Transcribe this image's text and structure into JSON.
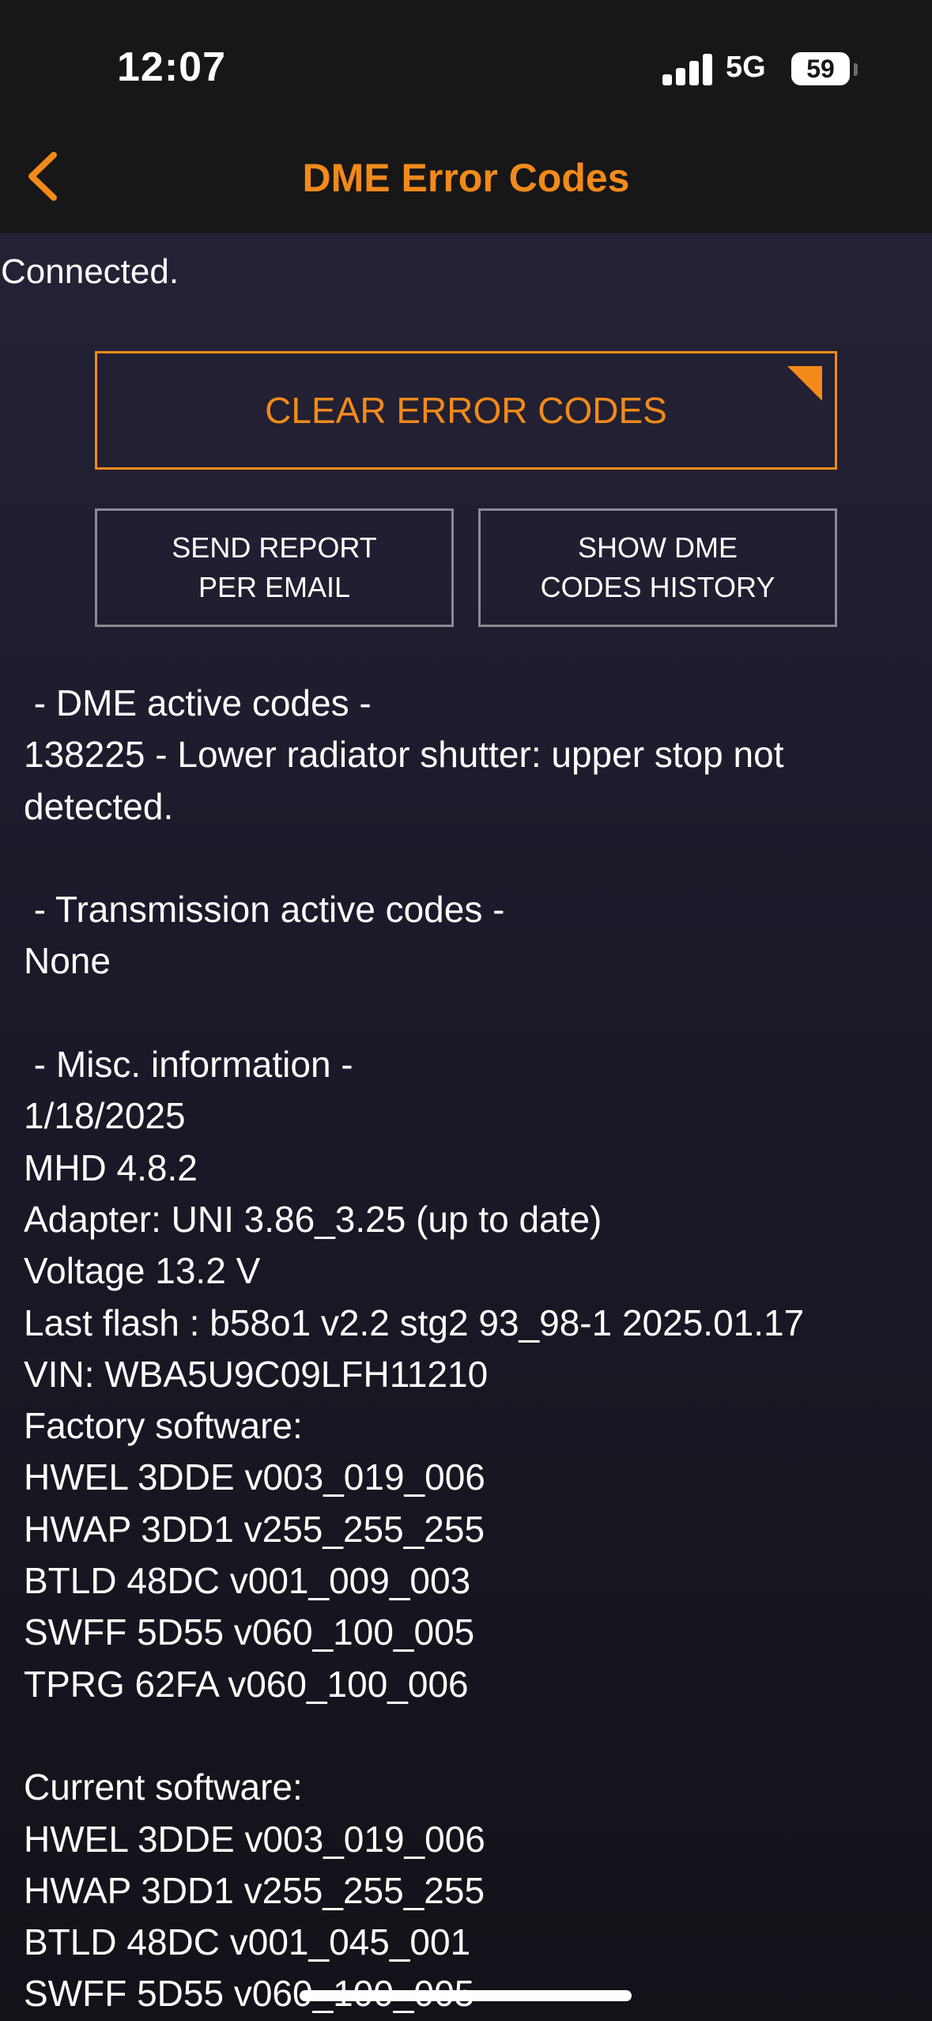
{
  "status_bar": {
    "time": "12:07",
    "network": "5G",
    "battery": "59"
  },
  "nav": {
    "title": "DME Error Codes",
    "back_icon": "chevron-left-icon"
  },
  "connection_status": "Connected.",
  "buttons": {
    "clear_error_codes": "CLEAR ERROR CODES",
    "send_report_line1": "SEND REPORT",
    "send_report_line2": "PER EMAIL",
    "show_history_line1": "SHOW DME",
    "show_history_line2": "CODES HISTORY"
  },
  "report": {
    "lines": [
      " - DME active codes -",
      "138225 - Lower radiator shutter: upper stop not detected.",
      "",
      " - Transmission active codes -",
      "None",
      "",
      " - Misc. information -",
      "1/18/2025",
      "MHD 4.8.2",
      "Adapter: UNI 3.86_3.25 (up to date)",
      "Voltage 13.2 V",
      "Last flash : b58o1 v2.2 stg2 93_98-1 2025.01.17",
      "VIN: WBA5U9C09LFH11210",
      "Factory software:",
      "HWEL 3DDE v003_019_006",
      "HWAP 3DD1 v255_255_255",
      "BTLD 48DC v001_009_003",
      "SWFF 5D55 v060_100_005",
      "TPRG 62FA v060_100_006",
      "",
      "Current software:",
      "HWEL 3DDE v003_019_006",
      "HWAP 3DD1 v255_255_255",
      "BTLD 48DC v001_045_001",
      "SWFF 5D55 v060_100_005"
    ]
  },
  "colors": {
    "accent": "#f28a1a",
    "bar_background": "#171717",
    "content_background": "#1b1a29"
  }
}
